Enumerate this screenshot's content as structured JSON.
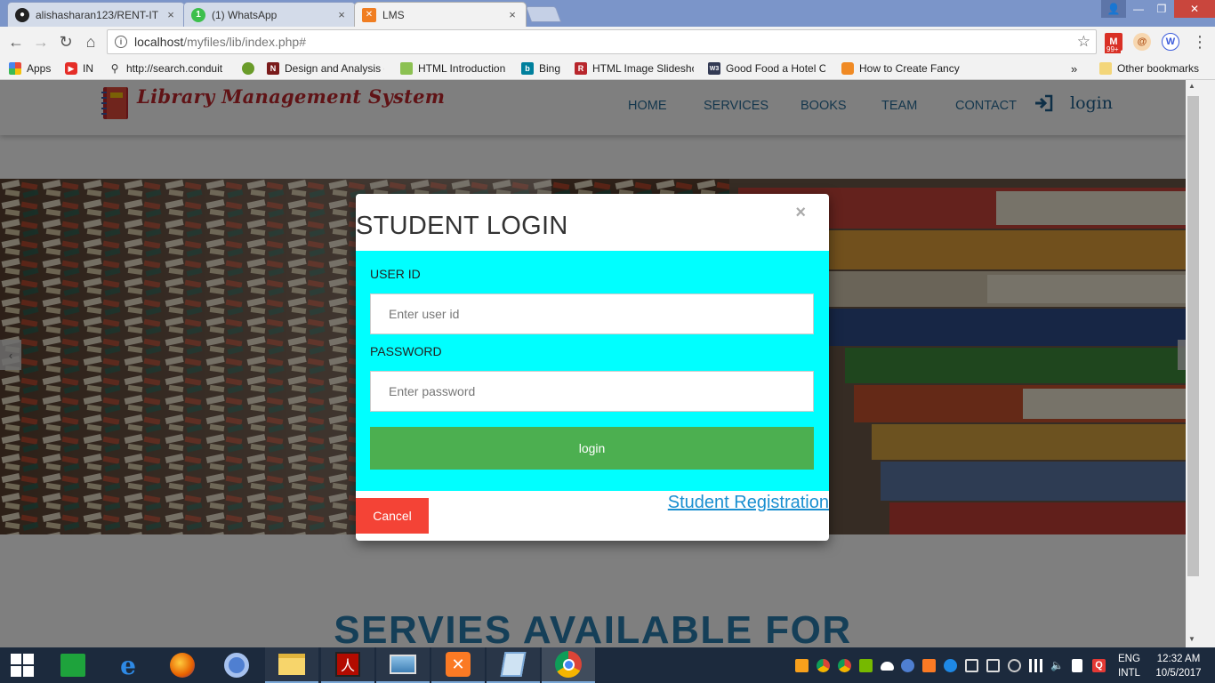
{
  "browser": {
    "tabs": [
      {
        "title": "alishasharan123/RENT-IT",
        "icon": "github-icon"
      },
      {
        "title": "(1) WhatsApp",
        "icon": "whatsapp-icon"
      },
      {
        "title": "LMS",
        "icon": "xampp-icon",
        "active": true
      }
    ],
    "close_glyph": "×",
    "url_host": "localhost",
    "url_path": "/myfiles/lib/index.php#",
    "mail_badge": "99+",
    "bookmarks": [
      {
        "label": "Apps",
        "icon": "apps-grid-icon"
      },
      {
        "label": "IN",
        "icon": "youtube-icon"
      },
      {
        "label": "http://search.conduit",
        "icon": "search-icon"
      },
      {
        "label": "",
        "icon": "bird-icon"
      },
      {
        "label": "Design and Analysis c",
        "icon": "n-icon"
      },
      {
        "label": "HTML Introduction",
        "icon": "chart-icon"
      },
      {
        "label": "Bing",
        "icon": "bing-icon"
      },
      {
        "label": "HTML Image Slidesho",
        "icon": "r-icon"
      },
      {
        "label": "Good Food a Hotel C",
        "icon": "w3-icon"
      },
      {
        "label": "How to Create Fancy",
        "icon": "cube-icon"
      }
    ],
    "bookmarks_overflow": "»",
    "other_bookmarks": "Other bookmarks"
  },
  "site": {
    "title": "Library Management System",
    "nav": [
      "HOME",
      "SERVICES",
      "BOOKS",
      "TEAM",
      "CONTACT"
    ],
    "login_label": "login",
    "services_heading": "SERVIES AVAILABLE FOR"
  },
  "modal": {
    "title": "STUDENT LOGIN",
    "close_glyph": "×",
    "user_label": "USER ID",
    "user_placeholder": "Enter user id",
    "password_label": "PASSWORD",
    "password_placeholder": "Enter password",
    "login_button": "login",
    "cancel_button": "Cancel",
    "register_link": "Student Registration"
  },
  "taskbar": {
    "apps": [
      "windows-start",
      "store",
      "internet-explorer",
      "firefox",
      "chromium",
      "file-explorer",
      "acrobat",
      "photos",
      "xampp",
      "notepad",
      "chrome"
    ],
    "lang_line1": "ENG",
    "lang_line2": "INTL",
    "time": "12:32 AM",
    "date": "10/5/2017"
  },
  "colors": {
    "modal_body": "#00ffff",
    "login_button": "#4caf50",
    "cancel_button": "#f44336",
    "site_title": "#c0262c",
    "nav_link": "#2b6f9a",
    "services_heading": "#2b7fb1"
  }
}
